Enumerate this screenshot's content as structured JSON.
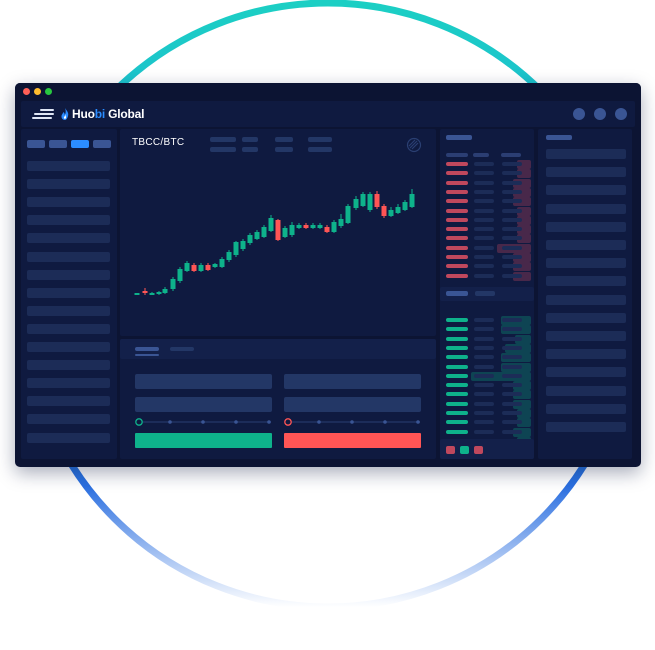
{
  "app": {
    "logo_text_1": "Huo",
    "logo_text_2": "bi",
    "logo_text_3": " Global"
  },
  "chart": {
    "pair": "TBCC/BTC"
  },
  "colors": {
    "ring_top": "#1ccfc4",
    "ring_bottom": "#2b6fe0",
    "window_bg": "#0c1433",
    "panel_bg": "#0f1a40",
    "placeholder": "#233766",
    "accent_blue": "#2b8cff",
    "up": "#0eb28b",
    "down": "#ff5555",
    "dot_red": "#ff5f57",
    "dot_yellow": "#febc2e",
    "dot_green": "#28c840"
  }
}
